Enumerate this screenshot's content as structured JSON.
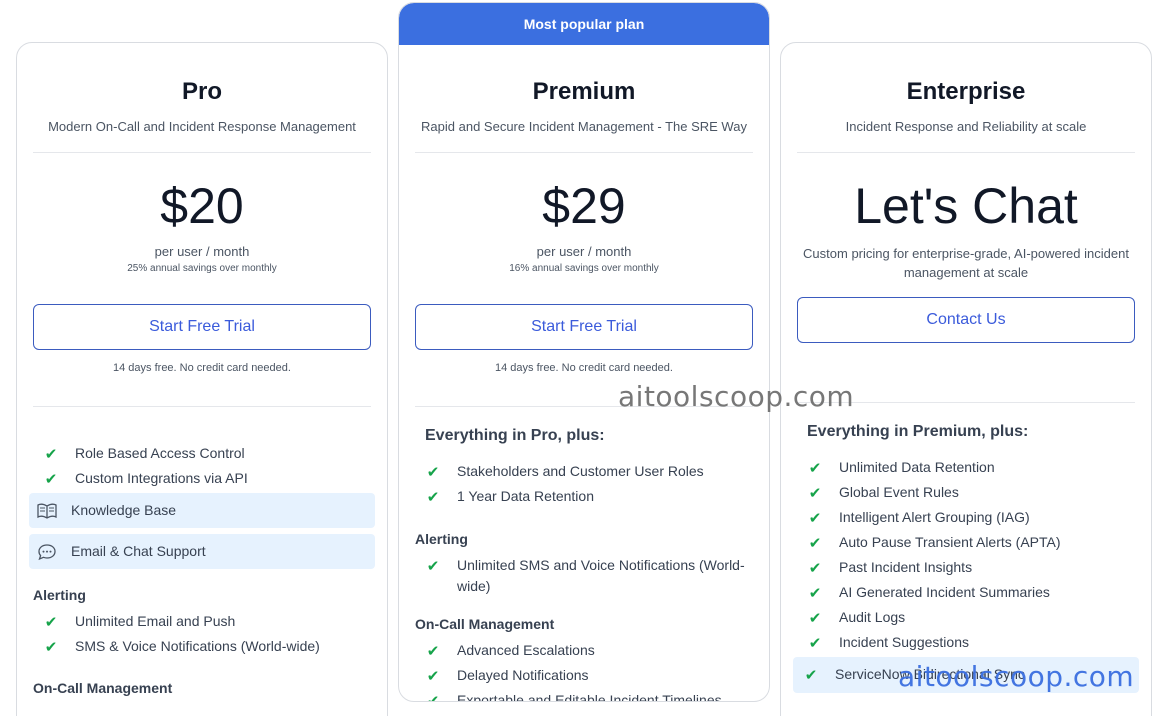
{
  "banner": "Most popular plan",
  "plans": {
    "pro": {
      "name": "Pro",
      "desc": "Modern On-Call and Incident Response Management",
      "price": "$20",
      "unit": "per user / month",
      "note": "25% annual savings over monthly",
      "cta": "Start Free Trial",
      "cta_note": "14 days free. No credit card needed.",
      "features": [
        "Role Based Access Control",
        "Custom Integrations via API"
      ],
      "highlight": [
        "Knowledge Base",
        "Email & Chat Support"
      ],
      "alerting_title": "Alerting",
      "alerting": [
        "Unlimited Email and Push",
        "SMS & Voice Notifications (World-wide)"
      ],
      "oncall_title": "On-Call Management"
    },
    "premium": {
      "name": "Premium",
      "desc": "Rapid and Secure Incident Management - The SRE Way",
      "price": "$29",
      "unit": "per user / month",
      "note": "16% annual savings over monthly",
      "cta": "Start Free Trial",
      "cta_note": "14 days free. No credit card needed.",
      "lead": "Everything in Pro, plus:",
      "features": [
        "Stakeholders and Customer User Roles",
        "1 Year Data Retention"
      ],
      "alerting_title": "Alerting",
      "alerting": [
        "Unlimited SMS and Voice Notifications (World-wide)"
      ],
      "oncall_title": "On-Call Management",
      "oncall": [
        "Advanced Escalations",
        "Delayed Notifications",
        "Exportable and Editable Incident Timelines"
      ]
    },
    "enterprise": {
      "name": "Enterprise",
      "desc": "Incident Response and Reliability at scale",
      "price": "Let's Chat",
      "custom": "Custom pricing for enterprise-grade, AI-powered incident management at scale",
      "cta": "Contact Us",
      "lead": "Everything in Premium, plus:",
      "features": [
        "Unlimited Data Retention",
        "Global Event Rules",
        "Intelligent Alert Grouping (IAG)",
        "Auto Pause Transient Alerts (APTA)",
        "Past Incident Insights",
        "AI Generated Incident Summaries",
        "Audit Logs",
        "Incident Suggestions"
      ],
      "highlight": [
        "ServiceNow Bidirectional Sync"
      ]
    }
  },
  "watermarks": [
    "aitoolscoop.com",
    "aitoolscoop.com"
  ],
  "colors": {
    "accent": "#3b6fe0",
    "check": "#16a34a",
    "highlight_bg": "#e6f2fe"
  },
  "icons": {
    "check": "check-icon",
    "book": "book-icon",
    "chat": "chat-bubble-icon"
  }
}
